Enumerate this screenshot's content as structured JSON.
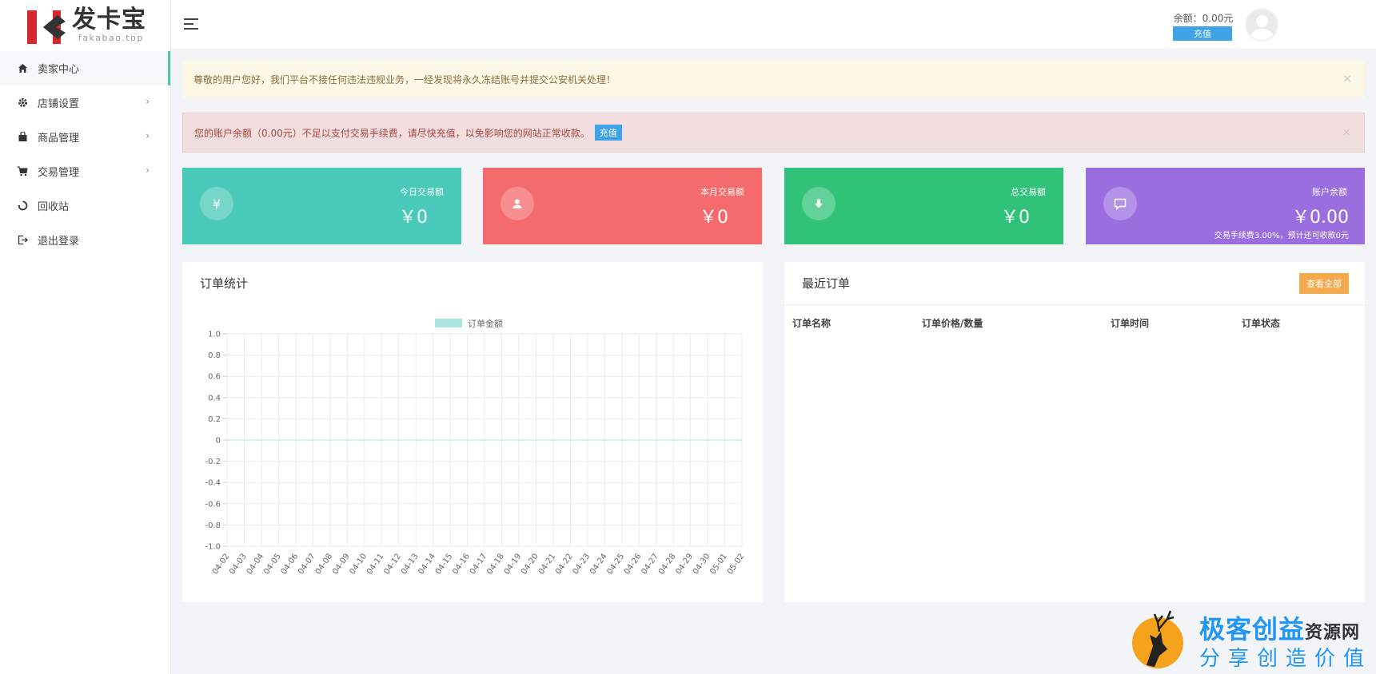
{
  "brand": {
    "name": "发卡宝",
    "domain": "fakabao.top"
  },
  "sidebar": {
    "items": [
      {
        "label": "卖家中心",
        "icon": "home-icon",
        "active": true,
        "has_children": false
      },
      {
        "label": "店铺设置",
        "icon": "gear-icon",
        "active": false,
        "has_children": true
      },
      {
        "label": "商品管理",
        "icon": "bag-icon",
        "active": false,
        "has_children": true
      },
      {
        "label": "交易管理",
        "icon": "cart-icon",
        "active": false,
        "has_children": true
      },
      {
        "label": "回收站",
        "icon": "recycle-icon",
        "active": false,
        "has_children": false
      },
      {
        "label": "退出登录",
        "icon": "logout-icon",
        "active": false,
        "has_children": false
      }
    ]
  },
  "header": {
    "balance_label": "余额：0.00元",
    "recharge_label": "充值"
  },
  "alerts": {
    "warning": "尊敬的用户您好，我们平台不接任何违法违规业务，一经发现将永久冻结账号并提交公安机关处理！",
    "danger": "您的账户余额（0.00元）不足以支付交易手续费，请尽快充值，以免影响您的网站正常收款。",
    "danger_button": "充值",
    "close": "×"
  },
  "stats": [
    {
      "label": "今日交易额",
      "value": "￥0",
      "icon": "yen-icon",
      "color": "#48c9b9"
    },
    {
      "label": "本月交易额",
      "value": "￥0",
      "icon": "user-icon",
      "color": "#f56a6d"
    },
    {
      "label": "总交易额",
      "value": "￥0",
      "icon": "download-icon",
      "color": "#2fc278"
    },
    {
      "label": "账户余额",
      "value": "￥0.00",
      "icon": "message-icon",
      "color": "#9b6ee0",
      "note": "交易手续费3.00%，预计还可收款0元"
    }
  ],
  "chart_panel": {
    "title": "订单统计"
  },
  "chart_data": {
    "type": "line",
    "legend": "订单金额",
    "legend_color": "#a8e6dd",
    "ylim": [
      -1.0,
      1.0
    ],
    "yticks": [
      "1.0",
      "0.8",
      "0.6",
      "0.4",
      "0.2",
      "0",
      "-0.2",
      "-0.4",
      "-0.6",
      "-0.8",
      "-1.0"
    ],
    "x": [
      "04-02",
      "04-03",
      "04-04",
      "04-05",
      "04-06",
      "04-07",
      "04-08",
      "04-09",
      "04-10",
      "04-11",
      "04-12",
      "04-13",
      "04-14",
      "04-15",
      "04-16",
      "04-17",
      "04-18",
      "04-19",
      "04-20",
      "04-21",
      "04-22",
      "04-23",
      "04-24",
      "04-25",
      "04-26",
      "04-27",
      "04-28",
      "04-29",
      "04-30",
      "05-01",
      "05-02"
    ],
    "series": [
      {
        "name": "订单金额",
        "values": [
          0,
          0,
          0,
          0,
          0,
          0,
          0,
          0,
          0,
          0,
          0,
          0,
          0,
          0,
          0,
          0,
          0,
          0,
          0,
          0,
          0,
          0,
          0,
          0,
          0,
          0,
          0,
          0,
          0,
          0,
          0
        ]
      }
    ],
    "grid": true
  },
  "orders_panel": {
    "title": "最近订单",
    "view_all": "查看全部",
    "columns": [
      "订单名称",
      "订单价格/数量",
      "订单时间",
      "订单状态"
    ]
  },
  "watermark": {
    "title_main": "极客创益",
    "title_small": "资源网",
    "subtitle": "分享创造价值"
  }
}
